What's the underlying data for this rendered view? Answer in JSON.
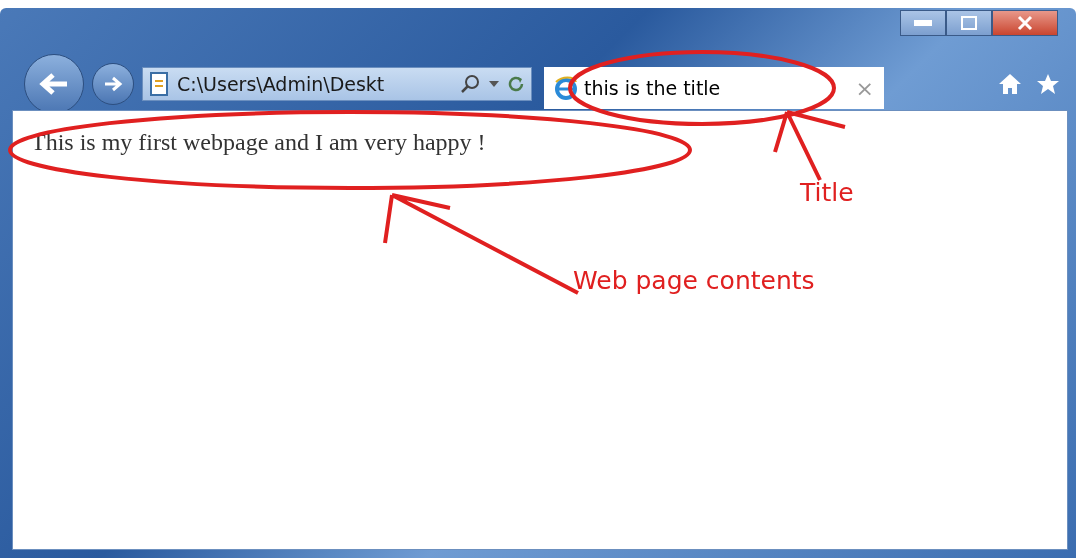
{
  "address_bar": {
    "value": "C:\\Users\\Admin\\Deskt"
  },
  "tabs": [
    {
      "title": "this is the title",
      "close": "×",
      "selected": true
    }
  ],
  "page_content": {
    "text": "This is my first webpage and I am very happy !"
  },
  "annotations": [
    {
      "kind": "title",
      "label": "Title"
    },
    {
      "kind": "content",
      "label": "Web page contents"
    }
  ]
}
